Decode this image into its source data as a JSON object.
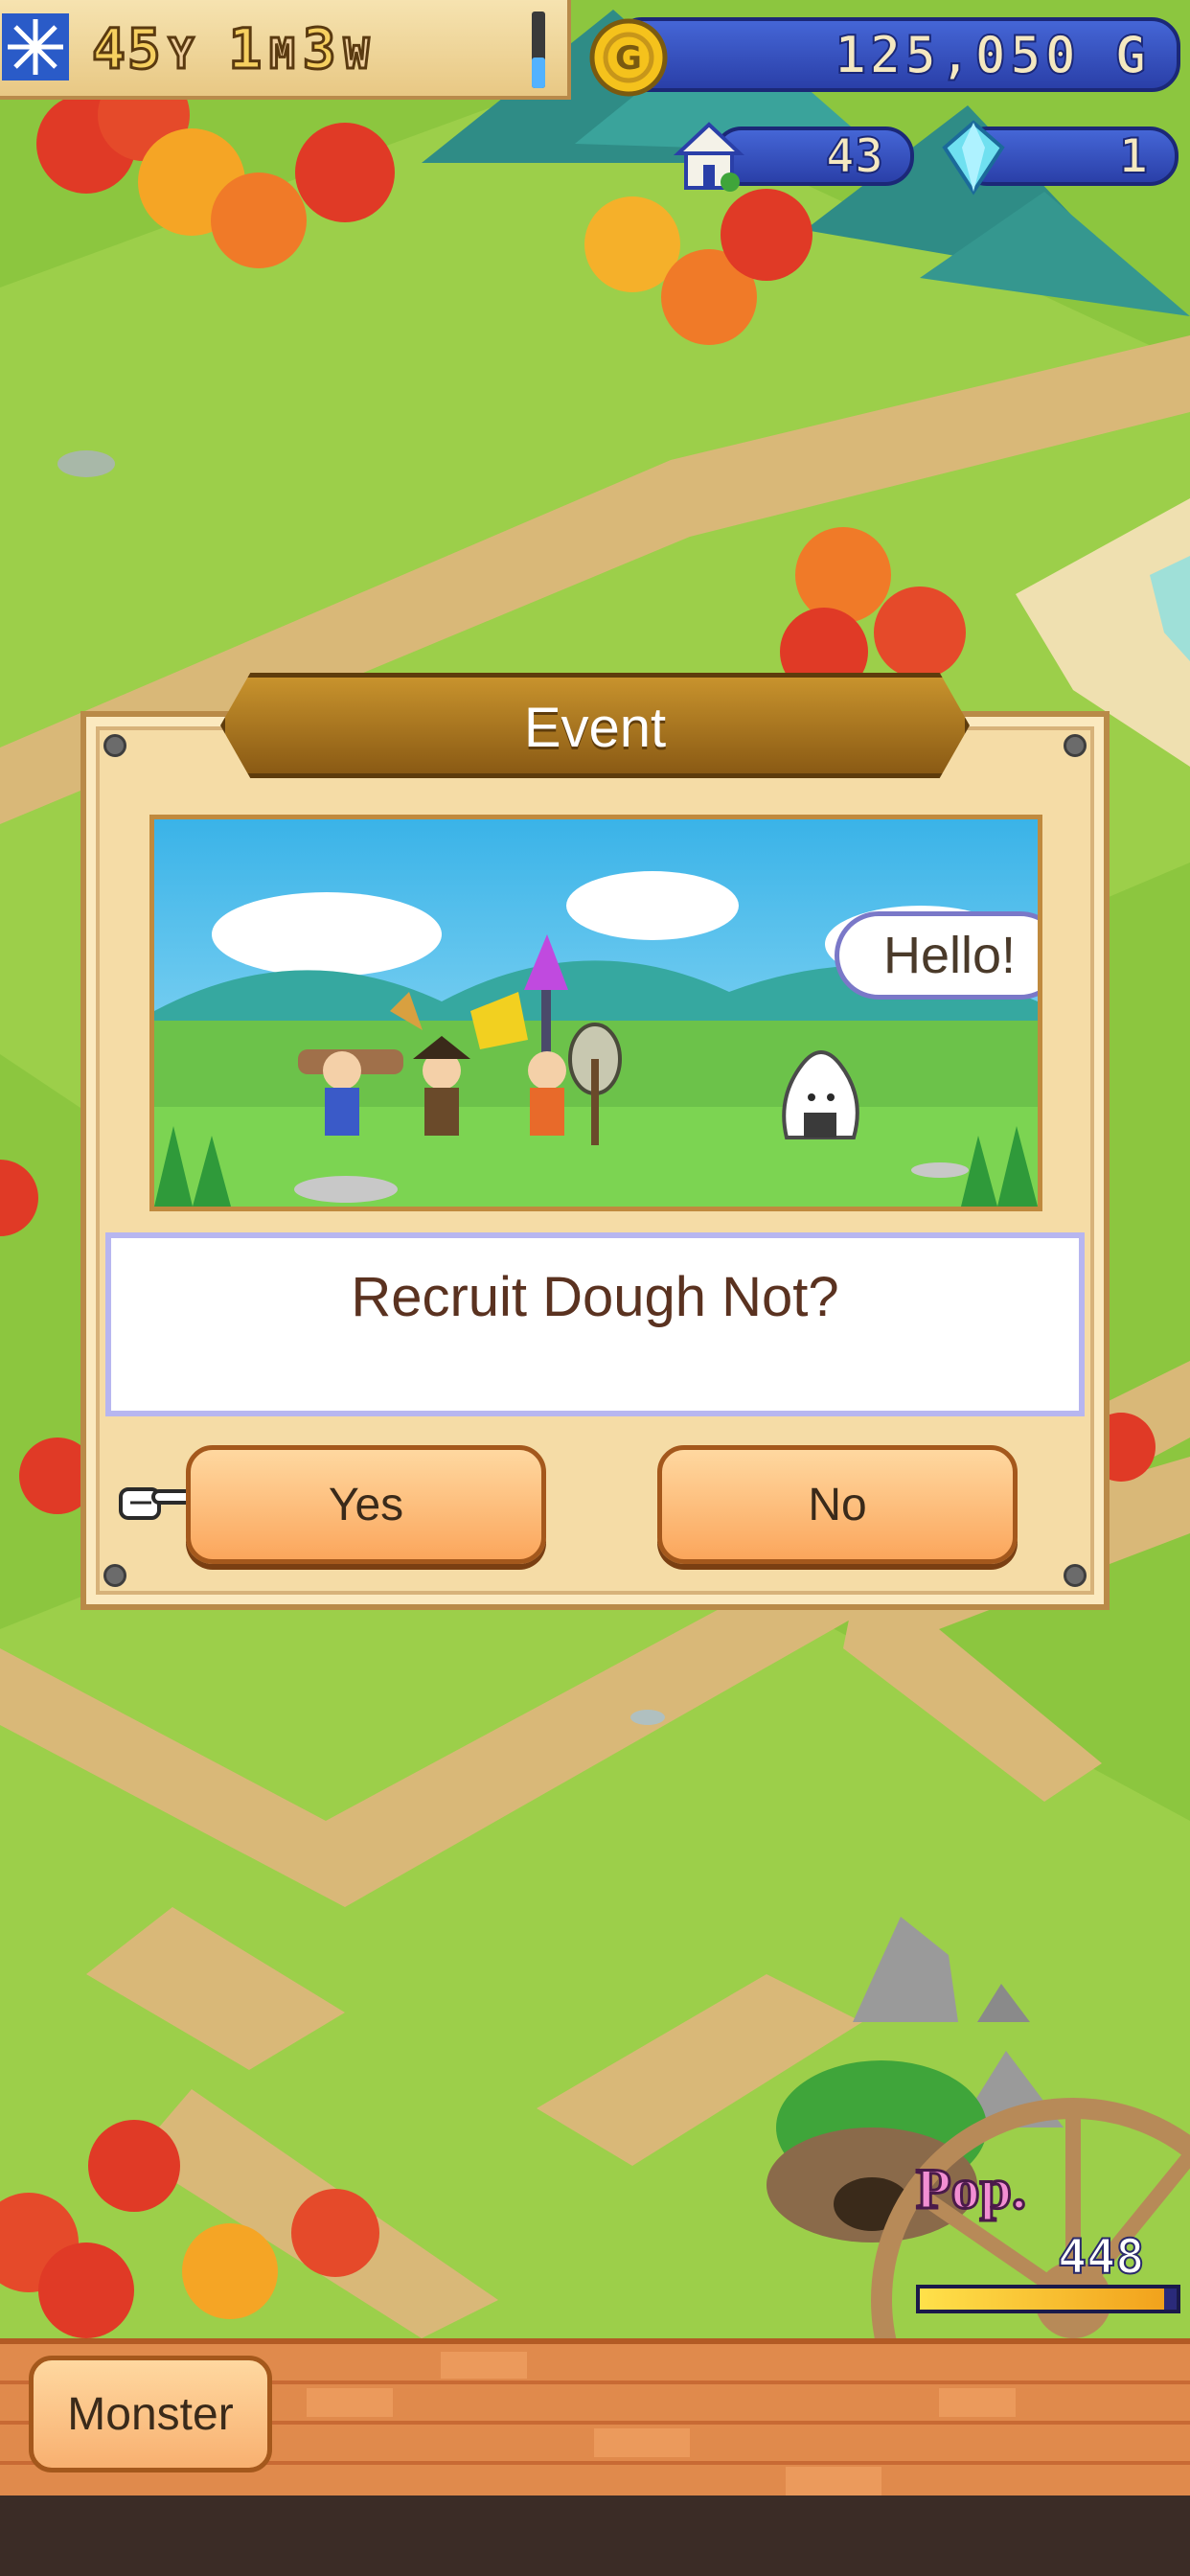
{
  "hud": {
    "year_value": "45",
    "year_unit": "Y",
    "month_value": "1",
    "month_unit": "M",
    "week_value": "3",
    "week_unit": "W",
    "week_progress": 0.4,
    "gold": "125,050 G",
    "houses": "43",
    "crystals": "1",
    "icons": [
      "snowflake-icon",
      "gold-coin-icon",
      "house-icon",
      "crystal-icon"
    ]
  },
  "dialog": {
    "title": "Event",
    "speech_bubble": "Hello!",
    "message": "Recruit Dough Not?",
    "yes_label": "Yes",
    "no_label": "No",
    "selected": "Yes"
  },
  "population": {
    "label": "Pop.",
    "value": "448",
    "meter_fill": 0.95
  },
  "bottom_bar": {
    "monster_label": "Monster"
  },
  "colors": {
    "grass": "#8cc63f",
    "path": "#d9b878",
    "dialog_bg": "#f5dca6",
    "banner": "#a8741f",
    "button": "#fba65c",
    "hud_blue": "#2a3fa8",
    "brick": "#e08a4c"
  }
}
